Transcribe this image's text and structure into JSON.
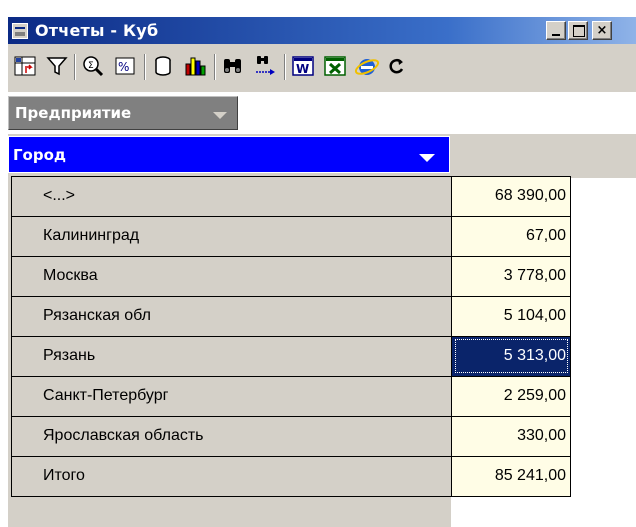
{
  "window": {
    "title": "Отчеты - Куб",
    "controls": {
      "minimize": "_",
      "maximize": "□",
      "close": "×"
    }
  },
  "toolbar": {
    "buttons": [
      {
        "name": "pivot-layout-icon"
      },
      {
        "name": "filter-icon"
      },
      {
        "name": "zoom-sum-icon"
      },
      {
        "name": "percent-icon"
      },
      {
        "name": "cylinder-icon"
      },
      {
        "name": "bar-chart-icon"
      },
      {
        "name": "binoculars-icon"
      },
      {
        "name": "find-next-icon"
      },
      {
        "name": "word-export-icon"
      },
      {
        "name": "excel-export-icon"
      },
      {
        "name": "internet-explorer-icon"
      },
      {
        "name": "refresh-icon"
      }
    ]
  },
  "fields": {
    "page_field": "Предприятие",
    "row_field": "Город"
  },
  "table": {
    "rows": [
      {
        "label": "<...>",
        "value": "68 390,00"
      },
      {
        "label": "Калининград",
        "value": "67,00"
      },
      {
        "label": "Москва",
        "value": "3 778,00"
      },
      {
        "label": "Рязанская обл",
        "value": "5 104,00"
      },
      {
        "label": "Рязань",
        "value": "5 313,00",
        "selected": true
      },
      {
        "label": "Санкт-Петербург",
        "value": "2 259,00"
      },
      {
        "label": "Ярославская область",
        "value": "330,00"
      },
      {
        "label": "Итого",
        "value": "85 241,00"
      }
    ]
  },
  "colors": {
    "row_field_bg": "#0000ff",
    "selected_cell_bg": "#0a246a",
    "value_cell_bg": "#fffde6",
    "face": "#d4d0c8"
  }
}
